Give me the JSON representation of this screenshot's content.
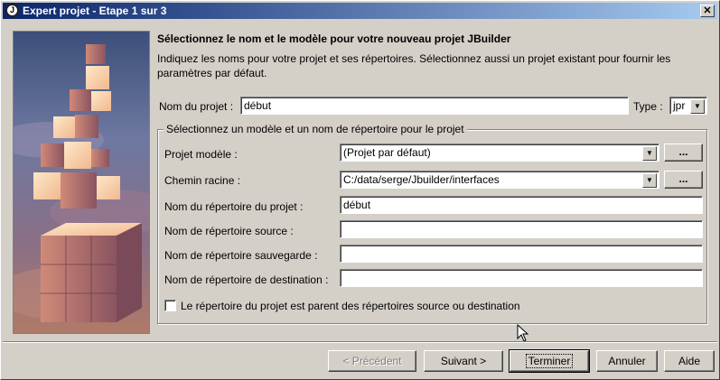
{
  "window": {
    "title": "Expert projet - Etape 1 sur 3"
  },
  "heading": "Sélectionnez le nom et le modèle pour votre nouveau projet JBuilder",
  "description": "Indiquez les noms pour votre projet et ses répertoires. Sélectionnez aussi un projet existant pour fournir les paramètres par défaut.",
  "project_name": {
    "label": "Nom du projet :",
    "value": "début"
  },
  "type": {
    "label": "Type :",
    "value": "jpr"
  },
  "group": {
    "title": "Sélectionnez un modèle et un nom de répertoire pour le projet",
    "template": {
      "label": "Projet modèle :",
      "value": "(Projet par défaut)",
      "browse": "..."
    },
    "root_path": {
      "label": "Chemin racine :",
      "value": "C:/data/serge/Jbuilder/interfaces",
      "browse": "..."
    },
    "project_dir": {
      "label": "Nom du répertoire du projet :",
      "value": "début"
    },
    "source_dir": {
      "label": "Nom de répertoire source :",
      "value": ""
    },
    "backup_dir": {
      "label": "Nom de répertoire sauvegarde :",
      "value": ""
    },
    "dest_dir": {
      "label": "Nom de répertoire de destination :",
      "value": ""
    },
    "parent_checkbox": {
      "label": "Le répertoire du projet est parent des répertoires source ou destination",
      "checked": false
    }
  },
  "buttons": {
    "previous": "< Précédent",
    "next": "Suivant >",
    "finish": "Terminer",
    "cancel": "Annuler",
    "help": "Aide"
  }
}
